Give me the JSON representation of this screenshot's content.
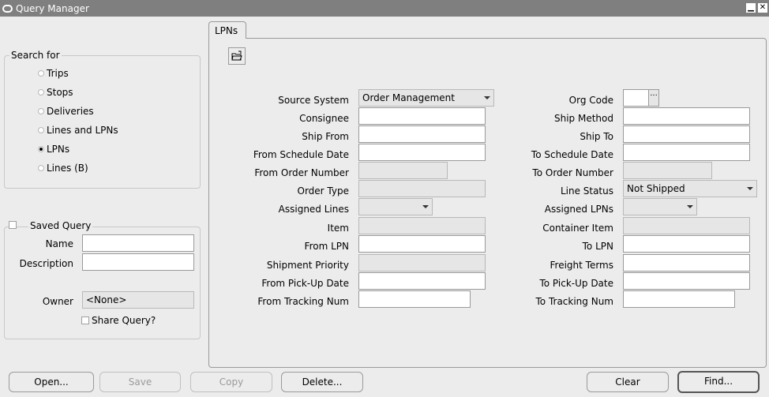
{
  "window": {
    "title": "Query Manager"
  },
  "search_for": {
    "legend": "Search for",
    "options": [
      {
        "label": "Trips",
        "selected": false
      },
      {
        "label": "Stops",
        "selected": false
      },
      {
        "label": "Deliveries",
        "selected": false
      },
      {
        "label": "Lines and LPNs",
        "selected": false
      },
      {
        "label": "LPNs",
        "selected": true
      },
      {
        "label": "Lines (B)",
        "selected": false
      }
    ]
  },
  "saved_query": {
    "legend": "Saved Query",
    "name_label": "Name",
    "name_value": "",
    "description_label": "Description",
    "description_value": "",
    "owner_label": "Owner",
    "owner_value": "<None>",
    "share_label": "Share Query?"
  },
  "tab": {
    "label": "LPNs"
  },
  "form": {
    "source_system": {
      "label": "Source System",
      "value": "Order Management"
    },
    "consignee": {
      "label": "Consignee",
      "value": ""
    },
    "ship_from": {
      "label": "Ship From",
      "value": ""
    },
    "from_schedule_date": {
      "label": "From Schedule Date",
      "value": ""
    },
    "from_order_number": {
      "label": "From Order Number",
      "value": ""
    },
    "order_type": {
      "label": "Order Type",
      "value": ""
    },
    "assigned_lines": {
      "label": "Assigned Lines",
      "value": ""
    },
    "item": {
      "label": "Item",
      "value": ""
    },
    "from_lpn": {
      "label": "From LPN",
      "value": ""
    },
    "shipment_priority": {
      "label": "Shipment Priority",
      "value": ""
    },
    "from_pickup_date": {
      "label": "From Pick-Up Date",
      "value": ""
    },
    "from_tracking_num": {
      "label": "From Tracking Num",
      "value": ""
    },
    "org_code": {
      "label": "Org Code",
      "value": ""
    },
    "ship_method": {
      "label": "Ship Method",
      "value": ""
    },
    "ship_to": {
      "label": "Ship To",
      "value": ""
    },
    "to_schedule_date": {
      "label": "To Schedule Date",
      "value": ""
    },
    "to_order_number": {
      "label": "To Order Number",
      "value": ""
    },
    "line_status": {
      "label": "Line Status",
      "value": "Not Shipped"
    },
    "assigned_lpns": {
      "label": "Assigned LPNs",
      "value": ""
    },
    "container_item": {
      "label": "Container Item",
      "value": ""
    },
    "to_lpn": {
      "label": "To LPN",
      "value": ""
    },
    "freight_terms": {
      "label": "Freight Terms",
      "value": ""
    },
    "to_pickup_date": {
      "label": "To Pick-Up Date",
      "value": ""
    },
    "to_tracking_num": {
      "label": "To Tracking Num",
      "value": ""
    }
  },
  "buttons": {
    "open": "Open...",
    "save": "Save",
    "copy": "Copy",
    "delete": "Delete...",
    "clear": "Clear",
    "find": "Find..."
  }
}
